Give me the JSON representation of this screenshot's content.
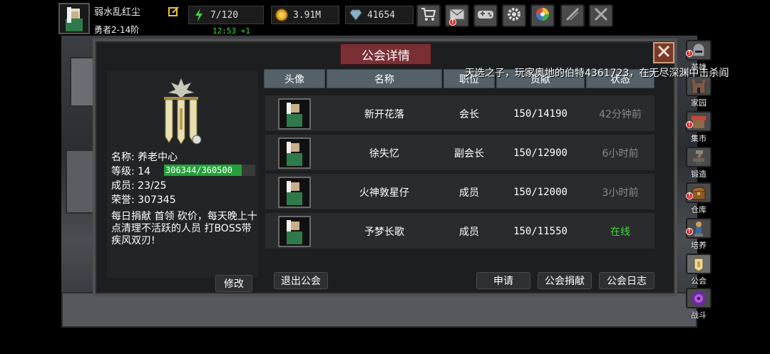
{
  "player": {
    "name": "弱水乱红尘",
    "rank": "勇者2-14阶"
  },
  "stats": {
    "stamina": "7/120",
    "stamina_timer": "12:53 +1",
    "gold": "3.91M",
    "gems": "41654"
  },
  "toolbar": [
    "shop-cart-icon",
    "mail-icon",
    "gamepad-icon",
    "gear-icon",
    "color-wheel-icon",
    "swords-icon",
    "crossed-swords-icon"
  ],
  "sidebar": [
    {
      "label": "英雄",
      "icon": "knight-helmet-icon",
      "badge": true
    },
    {
      "label": "家园",
      "icon": "castle-icon",
      "badge": false
    },
    {
      "label": "集市",
      "icon": "market-stall-icon",
      "badge": true
    },
    {
      "label": "锻造",
      "icon": "anvil-hammer-icon",
      "badge": false
    },
    {
      "label": "仓库",
      "icon": "treasure-chest-icon",
      "badge": true
    },
    {
      "label": "培养",
      "icon": "statue-icon",
      "badge": true
    },
    {
      "label": "公会",
      "icon": "guild-banner-icon",
      "badge": false
    },
    {
      "label": "战斗",
      "icon": "portal-icon",
      "badge": false
    }
  ],
  "notice": "天选之子，玩家奥地的伯特4361723，在无尽深渊中击杀阎",
  "panel": {
    "title": "公会详情"
  },
  "guild": {
    "name_line": "名称: 养老中心",
    "level_label": "等级: 14",
    "exp_text": "306344/360500",
    "exp_fraction": 0.8498,
    "members_line": "成员: 23/25",
    "honor_line": "荣誉: 307345",
    "announcement": "每日捐献 首领 砍价，每天晚上十点清理不活跃的人员 打BOSS带疾风双刃!"
  },
  "buttons": {
    "modify": "修改",
    "leave": "退出公会",
    "apply": "申请",
    "donate": "公会捐献",
    "log": "公会日志"
  },
  "table": {
    "headers": [
      "头像",
      "名称",
      "职位",
      "贡献",
      "状态"
    ],
    "rows": [
      {
        "name": "新开花落",
        "position": "会长",
        "contribution": "150/14190",
        "status": "42分钟前",
        "online": false
      },
      {
        "name": "徐失忆",
        "position": "副会长",
        "contribution": "150/12900",
        "status": "6小时前",
        "online": false
      },
      {
        "name": "火神敦星仔",
        "position": "成员",
        "contribution": "150/12000",
        "status": "3小时前",
        "online": false
      },
      {
        "name": "予梦长歌",
        "position": "成员",
        "contribution": "150/11550",
        "status": "在线",
        "online": true
      }
    ]
  },
  "colors": {
    "online": "#3fd93f",
    "offline": "#8a8a8a",
    "exp": "#24a03a",
    "title_bg": "#7a2f35"
  }
}
